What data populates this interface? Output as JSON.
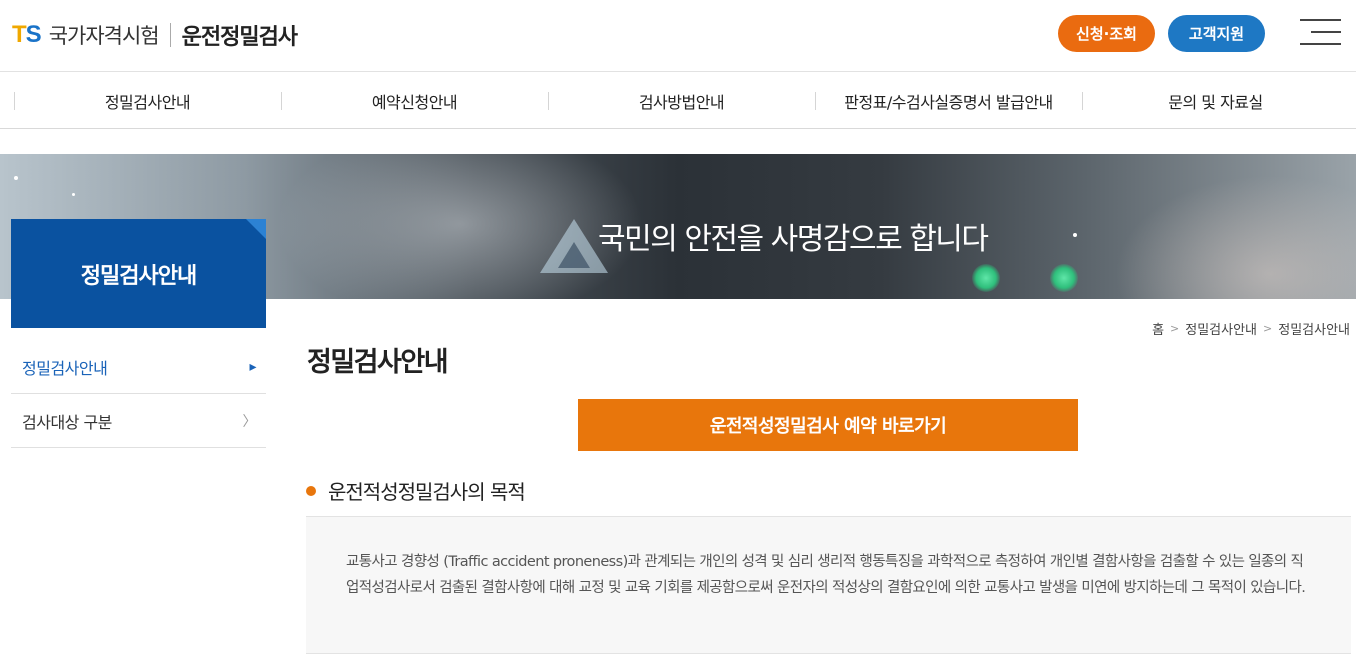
{
  "header": {
    "logo_mark": "TS",
    "org_name": "국가자격시험",
    "site_title": "운전정밀검사",
    "apply_label": "신청·조회",
    "support_label": "고객지원",
    "menu_icon": "hamburger-menu-icon"
  },
  "gnb": {
    "items": [
      {
        "label": "정밀검사안내"
      },
      {
        "label": "예약신청안내"
      },
      {
        "label": "검사방법안내"
      },
      {
        "label": "판정표/수검사실증명서 발급안내"
      },
      {
        "label": "문의 및 자료실"
      }
    ]
  },
  "banner": {
    "slogan": "국민의 안전을 사명감으로 합니다"
  },
  "sidebar": {
    "title": "정밀검사안내",
    "items": [
      {
        "label": "정밀검사안내",
        "active": true
      },
      {
        "label": "검사대상 구분",
        "active": false
      }
    ]
  },
  "breadcrumb": {
    "home": "홈",
    "level1": "정밀검사안내",
    "level2": "정밀검사안내"
  },
  "content": {
    "title": "정밀검사안내",
    "cta_label": "운전적성정밀검사 예약 바로가기",
    "section_title": "운전적성정밀검사의 목적",
    "section_body": "교통사고 경향성 (Traffic accident proneness)과 관계되는 개인의 성격 및 심리 생리적 행동특징을 과학적으로 측정하여 개인별 결함사항을 검출할 수 있는 일종의 직업적성검사로서 검출된 결함사항에 대해 교정 및 교육 기회를 제공함으로써 운전자의 적성상의 결함요인에 의한 교통사고 발생을 미연에 방지하는데 그 목적이 있습니다."
  },
  "colors": {
    "brand_blue": "#0a52a0",
    "accent_orange": "#e8760c",
    "support_blue": "#1e78c4"
  }
}
